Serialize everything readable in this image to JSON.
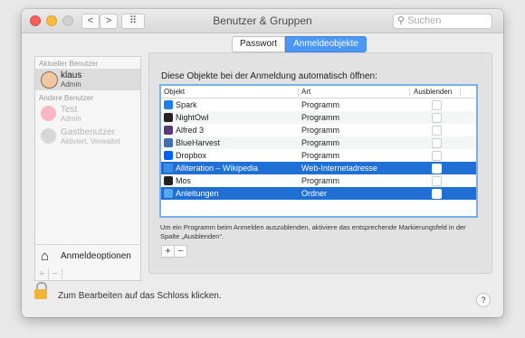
{
  "window": {
    "title": "Benutzer & Gruppen",
    "search_placeholder": "Suchen",
    "nav_back": "<",
    "nav_forward": ">",
    "grid_label": "⠿"
  },
  "sidebar": {
    "current_label": "Aktueller Benutzer",
    "current_user": {
      "name": "klaus",
      "role": "Admin"
    },
    "others_label": "Andere Benutzer",
    "others": [
      {
        "name": "Test",
        "role": "Admin"
      },
      {
        "name": "Gastbenutzer",
        "role": "Aktiviert, Verwaltet"
      }
    ],
    "login_options": "Anmeldeoptionen",
    "add": "+",
    "remove": "−"
  },
  "tabs": {
    "password": "Passwort",
    "login_items": "Anmeldeobjekte"
  },
  "heading": "Diese Objekte bei der Anmeldung automatisch öffnen:",
  "table": {
    "columns": [
      "Objekt",
      "Art",
      "Ausblenden"
    ],
    "rows": [
      {
        "name": "Spark",
        "kind": "Programm",
        "icon": "spark-icon",
        "color": "#1e7cf2"
      },
      {
        "name": "NightOwl",
        "kind": "Programm",
        "icon": "owl-icon",
        "color": "#222222"
      },
      {
        "name": "Alfred 3",
        "kind": "Programm",
        "icon": "alfred-icon",
        "color": "#5b3a7a"
      },
      {
        "name": "BlueHarvest",
        "kind": "Programm",
        "icon": "harvest-icon",
        "color": "#3f6fb3"
      },
      {
        "name": "Dropbox",
        "kind": "Programm",
        "icon": "dropbox-icon",
        "color": "#0061fe"
      },
      {
        "name": "Alliteration – Wikipedia",
        "kind": "Web-Internetadresse",
        "icon": "weblink-icon",
        "color": "#3a8ee6"
      },
      {
        "name": "Mos",
        "kind": "Programm",
        "icon": "mos-icon",
        "color": "#222222"
      },
      {
        "name": "Anleitungen",
        "kind": "Ordner",
        "icon": "folder-icon",
        "color": "#57a6f1"
      }
    ]
  },
  "info": "Um ein Programm beim Anmelden auszublenden, aktiviere das entsprechende Markierungsfeld in der Spalte „Ausblenden“.",
  "controls": {
    "add": "+",
    "remove": "−"
  },
  "lock_text": "Zum Bearbeiten auf das Schloss klicken.",
  "help": "?"
}
